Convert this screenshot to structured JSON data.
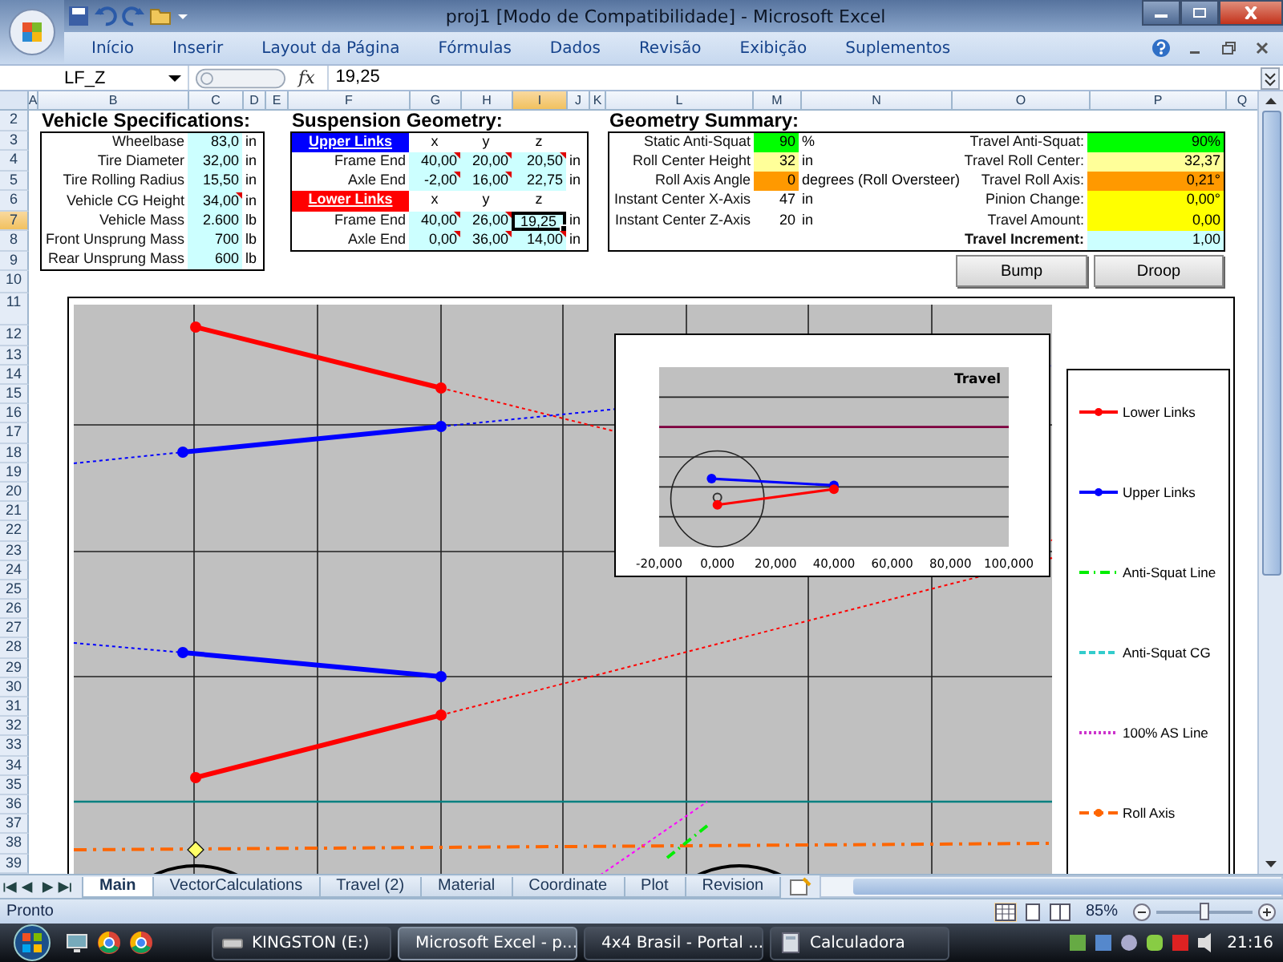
{
  "window": {
    "title": "proj1  [Modo de Compatibilidade] - Microsoft Excel"
  },
  "ribbon_tabs": [
    {
      "label": "Início"
    },
    {
      "label": "Inserir"
    },
    {
      "label": "Layout da Página"
    },
    {
      "label": "Fórmulas"
    },
    {
      "label": "Dados"
    },
    {
      "label": "Revisão"
    },
    {
      "label": "Exibição"
    },
    {
      "label": "Suplementos"
    }
  ],
  "formula_bar": {
    "name_box": "LF_Z",
    "function_label": "fx",
    "value": "19,25"
  },
  "columns": [
    {
      "label": "A",
      "selected": false
    },
    {
      "label": "B",
      "selected": false
    },
    {
      "label": "C",
      "selected": false
    },
    {
      "label": "D",
      "selected": false
    },
    {
      "label": "E",
      "selected": false
    },
    {
      "label": "F",
      "selected": false
    },
    {
      "label": "G",
      "selected": false
    },
    {
      "label": "H",
      "selected": false
    },
    {
      "label": "I",
      "selected": true
    },
    {
      "label": "J",
      "selected": false
    },
    {
      "label": "K",
      "selected": false
    },
    {
      "label": "L",
      "selected": false
    },
    {
      "label": "M",
      "selected": false
    },
    {
      "label": "N",
      "selected": false
    },
    {
      "label": "O",
      "selected": false
    },
    {
      "label": "P",
      "selected": false
    },
    {
      "label": "Q",
      "selected": false
    }
  ],
  "rows": [
    {
      "label": "2",
      "selected": false
    },
    {
      "label": "3",
      "selected": false
    },
    {
      "label": "4",
      "selected": false
    },
    {
      "label": "5",
      "selected": false
    },
    {
      "label": "6",
      "selected": false
    },
    {
      "label": "7",
      "selected": true
    },
    {
      "label": "8",
      "selected": false
    },
    {
      "label": "9",
      "selected": false
    },
    {
      "label": "10",
      "selected": false
    },
    {
      "label": "11",
      "selected": false
    },
    {
      "label": "12",
      "selected": false
    },
    {
      "label": "13",
      "selected": false
    },
    {
      "label": "14",
      "selected": false
    },
    {
      "label": "15",
      "selected": false
    },
    {
      "label": "16",
      "selected": false
    },
    {
      "label": "17",
      "selected": false
    },
    {
      "label": "18",
      "selected": false
    },
    {
      "label": "19",
      "selected": false
    },
    {
      "label": "20",
      "selected": false
    },
    {
      "label": "21",
      "selected": false
    },
    {
      "label": "22",
      "selected": false
    },
    {
      "label": "23",
      "selected": false
    },
    {
      "label": "24",
      "selected": false
    },
    {
      "label": "25",
      "selected": false
    },
    {
      "label": "26",
      "selected": false
    },
    {
      "label": "27",
      "selected": false
    },
    {
      "label": "28",
      "selected": false
    },
    {
      "label": "29",
      "selected": false
    },
    {
      "label": "30",
      "selected": false
    },
    {
      "label": "31",
      "selected": false
    },
    {
      "label": "32",
      "selected": false
    },
    {
      "label": "33",
      "selected": false
    },
    {
      "label": "34",
      "selected": false
    },
    {
      "label": "35",
      "selected": false
    },
    {
      "label": "36",
      "selected": false
    },
    {
      "label": "37",
      "selected": false
    },
    {
      "label": "38",
      "selected": false
    },
    {
      "label": "39",
      "selected": false
    }
  ],
  "vehicle_specs": {
    "title": "Vehicle Specifications:",
    "rows": [
      {
        "label": "Wheelbase",
        "value": "83,0",
        "unit": "in",
        "comment": false
      },
      {
        "label": "Tire Diameter",
        "value": "32,00",
        "unit": "in",
        "comment": false
      },
      {
        "label": "Tire Rolling Radius",
        "value": "15,50",
        "unit": "in",
        "comment": false
      },
      {
        "label": "Vehicle CG Height",
        "value": "34,00",
        "unit": "in",
        "comment": true
      },
      {
        "label": "Vehicle Mass",
        "value": "2.600",
        "unit": "lb",
        "comment": false
      },
      {
        "label": "Front Unsprung Mass",
        "value": "700",
        "unit": "lb",
        "comment": false
      },
      {
        "label": "Rear Unsprung Mass",
        "value": "600",
        "unit": "lb",
        "comment": false
      }
    ]
  },
  "suspension": {
    "title": "Suspension Geometry:",
    "groups": [
      {
        "name": "Upper Links",
        "color": "#0000ff",
        "axes": [
          "x",
          "y",
          "z"
        ],
        "rows": [
          {
            "label": "Frame End",
            "unit": "in",
            "cells": [
              {
                "value": "40,00",
                "comment": true,
                "selected": false
              },
              {
                "value": "20,00",
                "comment": true,
                "selected": false
              },
              {
                "value": "20,50",
                "comment": true,
                "selected": false
              }
            ]
          },
          {
            "label": "Axle End",
            "unit": "in",
            "cells": [
              {
                "value": "-2,00",
                "comment": true,
                "selected": false
              },
              {
                "value": "16,00",
                "comment": true,
                "selected": false
              },
              {
                "value": "22,75",
                "comment": false,
                "selected": false
              }
            ]
          }
        ]
      },
      {
        "name": "Lower Links",
        "color": "#ff0000",
        "axes": [
          "x",
          "y",
          "z"
        ],
        "rows": [
          {
            "label": "Frame End",
            "unit": "in",
            "cells": [
              {
                "value": "40,00",
                "comment": true,
                "selected": false
              },
              {
                "value": "26,00",
                "comment": true,
                "selected": false
              },
              {
                "value": "19,25",
                "comment": false,
                "selected": true
              }
            ]
          },
          {
            "label": "Axle End",
            "unit": "in",
            "cells": [
              {
                "value": "0,00",
                "comment": true,
                "selected": false
              },
              {
                "value": "36,00",
                "comment": true,
                "selected": false
              },
              {
                "value": "14,00",
                "comment": true,
                "selected": false
              }
            ]
          }
        ]
      }
    ]
  },
  "geometry_summary": {
    "title": "Geometry Summary:",
    "rows": [
      {
        "left": {
          "label": "Static Anti-Squat",
          "value": "90",
          "color": "#00ff00",
          "unit": "%"
        },
        "right": {
          "label": "Travel Anti-Squat:",
          "bold": false,
          "value": "90%",
          "color": "#00ff00"
        }
      },
      {
        "left": {
          "label": "Roll Center Height",
          "value": "32",
          "color": "#ffff99",
          "unit": "in"
        },
        "right": {
          "label": "Travel Roll Center:",
          "bold": false,
          "value": "32,37",
          "color": "#ffff99"
        }
      },
      {
        "left": {
          "label": "Roll Axis Angle",
          "value": "0",
          "color": "#ff9900",
          "unit": "degrees (Roll Oversteer)"
        },
        "right": {
          "label": "Travel Roll Axis:",
          "bold": false,
          "value": "0,21°",
          "color": "#ff9900"
        }
      },
      {
        "left": {
          "label": "Instant Center X-Axis",
          "value": "47",
          "color": "#ffffff",
          "unit": "in"
        },
        "right": {
          "label": "Pinion Change:",
          "bold": false,
          "value": "0,00°",
          "color": "#ffff00"
        }
      },
      {
        "left": {
          "label": "Instant Center Z-Axis",
          "value": "20",
          "color": "#ffffff",
          "unit": "in"
        },
        "right": {
          "label": "Travel Amount:",
          "bold": false,
          "value": "0,00",
          "color": "#ffff00"
        }
      },
      {
        "right": {
          "label": "Travel Increment:",
          "bold": true,
          "value": "1,00",
          "color": "#ccffff"
        }
      }
    ]
  },
  "buttons": [
    {
      "label": "Bump"
    },
    {
      "label": "Droop"
    }
  ],
  "travel_chart": {
    "title": "Travel",
    "x_tick_labels": [
      "-20,000",
      "0,000",
      "20,000",
      "40,000",
      "60,000",
      "80,000",
      "100,000"
    ]
  },
  "legend": [
    {
      "label": "Lower Links",
      "color": "#ff0000",
      "kind": "marker"
    },
    {
      "label": "Upper Links",
      "color": "#0000ff",
      "kind": "marker"
    },
    {
      "label": "Anti-Squat Line",
      "color": "#00ee00",
      "kind": "dashdot"
    },
    {
      "label": "Anti-Squat CG",
      "color": "#33cccc",
      "kind": "dashed"
    },
    {
      "label": "100% AS Line",
      "color": "#cc33cc",
      "kind": "dotted"
    },
    {
      "label": "Roll Axis",
      "color": "#ff6600",
      "kind": "dashmarker"
    }
  ],
  "sheet_tabs": [
    {
      "label": "Main",
      "selected": true
    },
    {
      "label": "VectorCalculations",
      "selected": false
    },
    {
      "label": "Travel (2)",
      "selected": false
    },
    {
      "label": "Material",
      "selected": false
    },
    {
      "label": "Coordinate",
      "selected": false
    },
    {
      "label": "Plot",
      "selected": false
    },
    {
      "label": "Revision",
      "selected": false
    }
  ],
  "status_bar": {
    "text": "Pronto",
    "zoom": "85%",
    "level": 0.5
  },
  "taskbar": {
    "buttons": [
      {
        "label": "KINGSTON (E:)",
        "kind": "drive",
        "selected": false
      },
      {
        "label": "Microsoft Excel - p...",
        "kind": "excel",
        "selected": true
      },
      {
        "label": "4x4 Brasil - Portal ...",
        "kind": "browser",
        "selected": false
      },
      {
        "label": "Calculadora",
        "kind": "calculator",
        "selected": false
      }
    ],
    "clock": "21:16"
  }
}
